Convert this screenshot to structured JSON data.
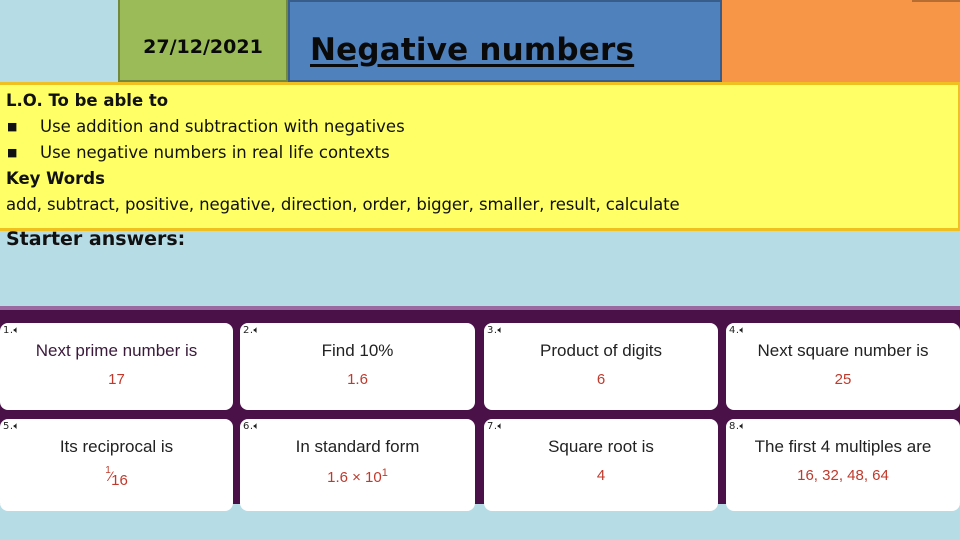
{
  "header": {
    "date": "27/12/2021",
    "title": "Negative numbers"
  },
  "colors": {
    "background": "#b6dce6",
    "date_box": "#9bbb59",
    "title_box": "#4f81bd",
    "accent_box": "#f79646",
    "objectives_box": "#ffff66",
    "card_frame": "#4a1048",
    "answer_text": "#c0392b"
  },
  "objectives": {
    "heading": "L.O. To be able to",
    "bullet_symbol": "§",
    "items": [
      "Use addition and subtraction with negatives",
      "Use negative numbers in real life contexts"
    ],
    "key_words_heading": "Key Words",
    "key_words": "add, subtract, positive, negative, direction, order, bigger, smaller, result, calculate"
  },
  "starter": {
    "heading": "Starter answers:",
    "cards": [
      {
        "number": "1.",
        "icon": "speaker-icon",
        "question": "Next prime number is",
        "answer": "17"
      },
      {
        "number": "2.",
        "icon": "speaker-icon",
        "question": "Find 10%",
        "answer": "1.6"
      },
      {
        "number": "3.",
        "icon": "speaker-icon",
        "question": "Product of digits",
        "answer": "6"
      },
      {
        "number": "4.",
        "icon": "speaker-icon",
        "question": "Next square number is",
        "answer": "25"
      },
      {
        "number": "5.",
        "icon": "speaker-icon",
        "question": "Its reciprocal is",
        "answer": "1/16",
        "answer_num": "1",
        "answer_den": "16"
      },
      {
        "number": "6.",
        "icon": "speaker-icon",
        "question": "In standard form",
        "answer": "1.6 × 10^1",
        "answer_base": "1.6 × 10",
        "answer_exp": "1"
      },
      {
        "number": "7.",
        "icon": "speaker-icon",
        "question": "Square root is",
        "answer": "4"
      },
      {
        "number": "8.",
        "icon": "speaker-icon",
        "question": "The first 4 multiples are",
        "answer": "16, 32, 48, 64"
      }
    ]
  }
}
